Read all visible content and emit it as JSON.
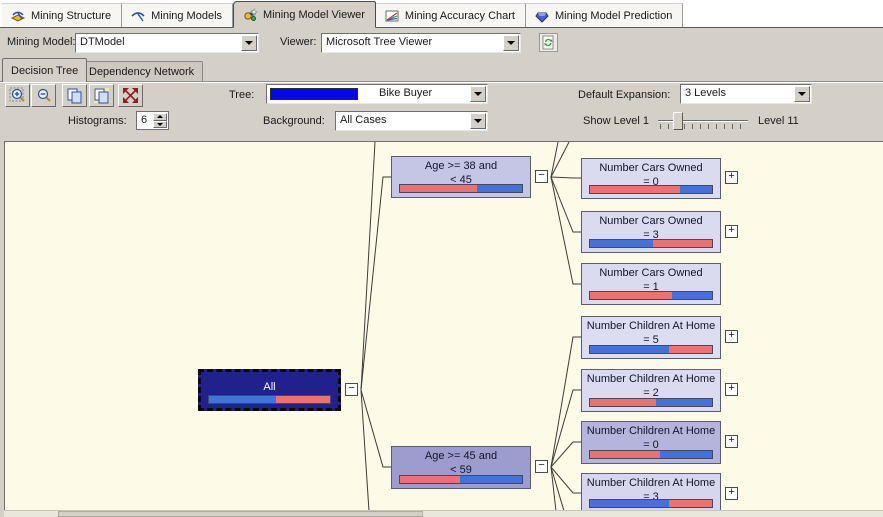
{
  "tabs": {
    "active": "Mining Model Viewer",
    "items": [
      {
        "label": "Mining Structure",
        "icon": "mining-structure-icon"
      },
      {
        "label": "Mining Models",
        "icon": "mining-models-icon"
      },
      {
        "label": "Mining Model Viewer",
        "icon": "mining-model-viewer-icon"
      },
      {
        "label": "Mining Accuracy Chart",
        "icon": "mining-accuracy-chart-icon"
      },
      {
        "label": "Mining Model Prediction",
        "icon": "mining-model-prediction-icon"
      }
    ]
  },
  "model_bar": {
    "mining_model_label": "Mining Model:",
    "mining_model_value": "DTModel",
    "viewer_label": "Viewer:",
    "viewer_value": "Microsoft Tree Viewer",
    "refresh_icon": "refresh-icon"
  },
  "view_tabs": {
    "active": "Decision Tree",
    "decision_tree_label": "Decision Tree",
    "dependency_network_label": "Dependency Network"
  },
  "toolbar": {
    "tree_label": "Tree:",
    "tree_value": "Bike Buyer",
    "tree_swatch_color": "#0505F0",
    "default_expansion_label": "Default Expansion:",
    "default_expansion_value": "3 Levels",
    "histograms_label": "Histograms:",
    "histograms_value": "6",
    "background_label": "Background:",
    "background_value": "All Cases",
    "show_level_label": "Show Level 1",
    "level_max_label": "Level 11",
    "slider_value": 1
  },
  "colors": {
    "chrome": "#D4D0C8",
    "canvas_bg": "#FDFAE7",
    "hist_blue": "#4472D8",
    "hist_salmon": "#EC7272",
    "connector": "#3c3c3c",
    "selected_node_fill": "#21218E"
  },
  "tree_nodes": [
    {
      "id": "all",
      "lines": [
        "All"
      ],
      "fill": "#21218E",
      "text_color": "#FFFFFF",
      "selected": true,
      "expander": "minus",
      "hist": [
        [
          "blue",
          55
        ],
        [
          "salmon",
          45
        ]
      ]
    },
    {
      "id": "age38",
      "lines": [
        "Age >= 38 and",
        "< 45"
      ],
      "fill": "#C5C5E6",
      "text_color": "#15152a",
      "selected": false,
      "expander": "minus",
      "hist": [
        [
          "salmon",
          63
        ],
        [
          "blue",
          37
        ]
      ]
    },
    {
      "id": "age45",
      "lines": [
        "Age >= 45 and",
        "< 59"
      ],
      "fill": "#9C9CCE",
      "text_color": "#15152a",
      "selected": false,
      "expander": "minus",
      "hist": [
        [
          "salmon",
          49
        ],
        [
          "blue",
          51
        ]
      ]
    },
    {
      "id": "cars0",
      "lines": [
        "Number Cars Owned",
        "= 0"
      ],
      "fill": "#DBDBF0",
      "text_color": "#15152a",
      "selected": false,
      "expander": "plus",
      "hist": [
        [
          "salmon",
          74
        ],
        [
          "blue",
          26
        ]
      ]
    },
    {
      "id": "cars3",
      "lines": [
        "Number Cars Owned",
        "= 3"
      ],
      "fill": "#DBDBF0",
      "text_color": "#15152a",
      "selected": false,
      "expander": "plus",
      "hist": [
        [
          "blue",
          52
        ],
        [
          "salmon",
          48
        ]
      ]
    },
    {
      "id": "cars1",
      "lines": [
        "Number Cars Owned",
        "= 1"
      ],
      "fill": "#DBDBF0",
      "text_color": "#15152a",
      "selected": false,
      "expander": null,
      "hist": [
        [
          "salmon",
          67
        ],
        [
          "blue",
          33
        ]
      ]
    },
    {
      "id": "kids5",
      "lines": [
        "Number Children At Home",
        "= 5"
      ],
      "fill": "#DDDDF2",
      "text_color": "#15152a",
      "selected": false,
      "expander": "plus",
      "hist": [
        [
          "blue",
          65
        ],
        [
          "salmon",
          35
        ]
      ]
    },
    {
      "id": "kids2",
      "lines": [
        "Number Children At Home",
        "= 2"
      ],
      "fill": "#DBDBF0",
      "text_color": "#15152a",
      "selected": false,
      "expander": "plus",
      "hist": [
        [
          "salmon",
          54
        ],
        [
          "blue",
          46
        ]
      ]
    },
    {
      "id": "kids0",
      "lines": [
        "Number Children At Home",
        "= 0"
      ],
      "fill": "#B4B4DC",
      "text_color": "#15152a",
      "selected": false,
      "expander": "plus",
      "hist": [
        [
          "salmon",
          57
        ],
        [
          "blue",
          43
        ]
      ]
    },
    {
      "id": "kids3",
      "lines": [
        "Number Children At Home",
        "= 3"
      ],
      "fill": "#D6D6EE",
      "text_color": "#15152a",
      "selected": false,
      "expander": "plus",
      "hist": [
        [
          "blue",
          65
        ],
        [
          "salmon",
          35
        ]
      ]
    }
  ],
  "expander_glyphs": {
    "minus": "−",
    "plus": "+"
  }
}
